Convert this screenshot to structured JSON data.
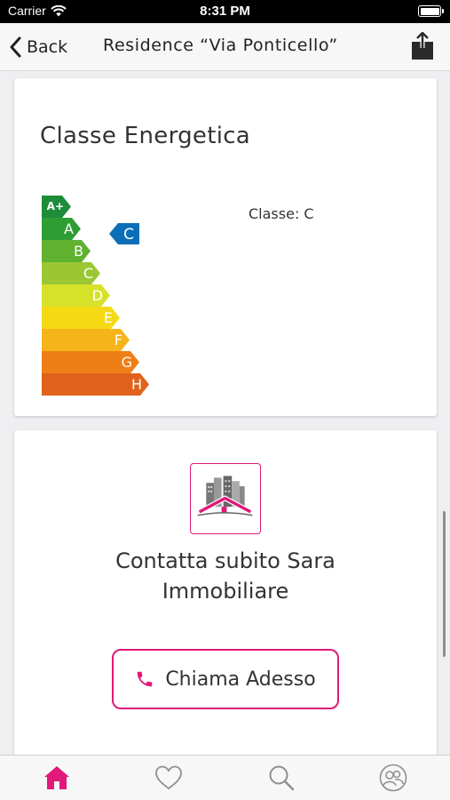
{
  "status_bar": {
    "carrier": "Carrier",
    "time": "8:31 PM"
  },
  "nav": {
    "back_label": "Back",
    "title": "Residence “Via Ponticello”",
    "share_icon": "share-icon"
  },
  "energy": {
    "title": "Classe Energetica",
    "class_text": "Classe: C",
    "current_class": "C",
    "scale": [
      {
        "letter": "A+",
        "color": "#1e8c3a"
      },
      {
        "letter": "A",
        "color": "#2e9e34"
      },
      {
        "letter": "B",
        "color": "#5fb12f"
      },
      {
        "letter": "C",
        "color": "#9bc832"
      },
      {
        "letter": "D",
        "color": "#d6e12a"
      },
      {
        "letter": "E",
        "color": "#f5d915"
      },
      {
        "letter": "F",
        "color": "#f6b41b"
      },
      {
        "letter": "G",
        "color": "#ee7f17"
      },
      {
        "letter": "H",
        "color": "#e0621b"
      }
    ],
    "indicator_color": "#0b6fb8"
  },
  "contact": {
    "logo_icon": "buildings-house-logo",
    "text_line1": "Contatta subito Sara",
    "text_line2": "Immobiliare",
    "call_label": "Chiama Adesso",
    "call_icon": "phone-icon"
  },
  "tabs": [
    {
      "name": "home",
      "icon": "home-icon",
      "active": true
    },
    {
      "name": "favorites",
      "icon": "heart-icon",
      "active": false
    },
    {
      "name": "search",
      "icon": "search-icon",
      "active": false
    },
    {
      "name": "contacts",
      "icon": "users-icon",
      "active": false
    }
  ],
  "colors": {
    "accent": "#e0197a",
    "inactive_icon": "#8e8e93"
  }
}
